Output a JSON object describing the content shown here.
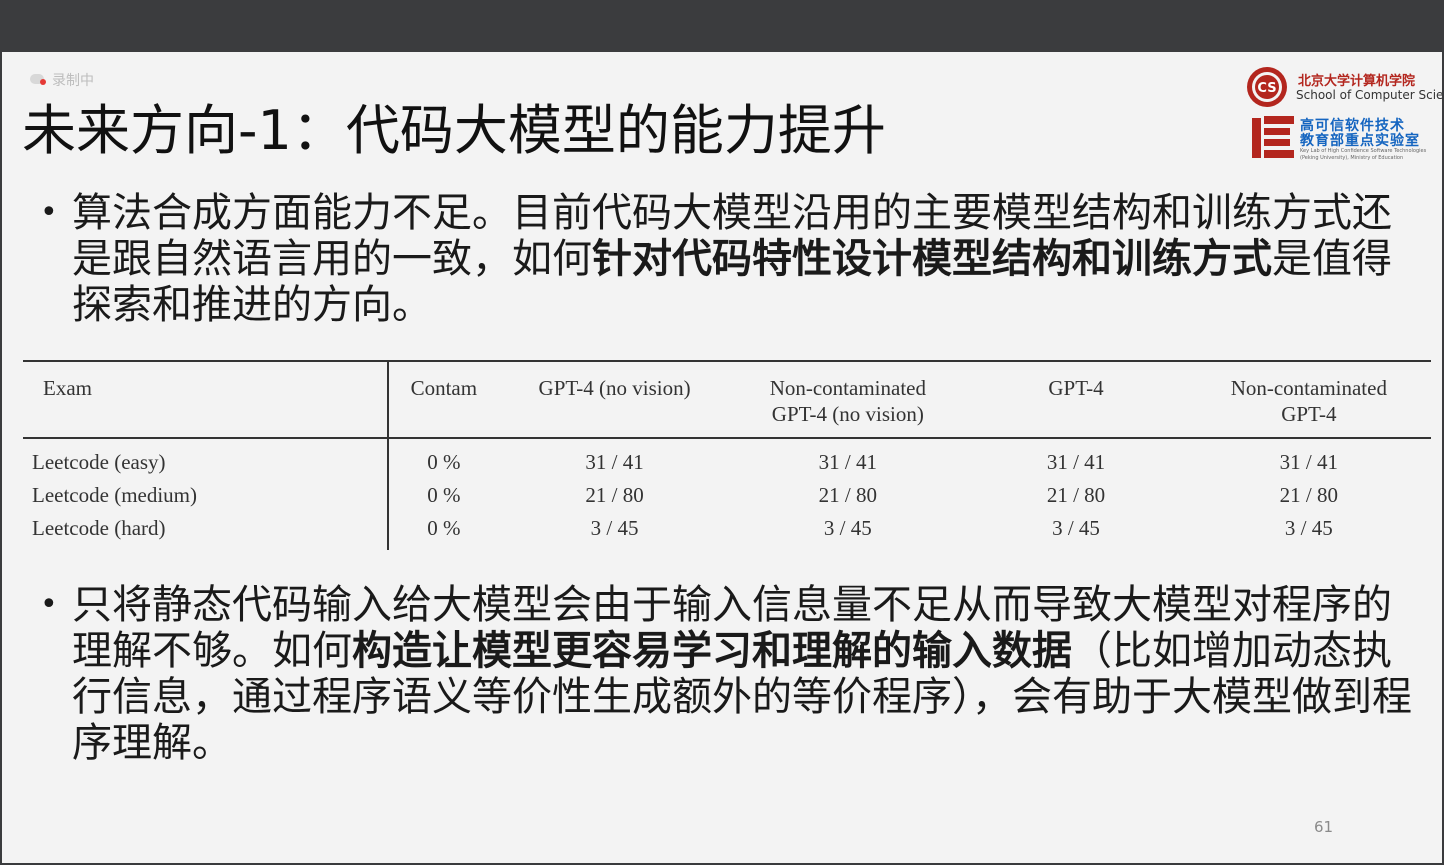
{
  "recording": {
    "label": "录制中"
  },
  "slide": {
    "title": "未来方向-1：代码大模型的能力提升",
    "page_number": "61"
  },
  "logos": {
    "cs_mark": "CS",
    "school_cn": "北京大学计算机学院",
    "school_en": "School of Computer Science",
    "lab_cn_line1": "高可信软件技术",
    "lab_cn_line2": "教育部重点实验室",
    "lab_en_line1": "Key Lab of High Confidence Software Technologies",
    "lab_en_line2": "(Peking University), Ministry of Education"
  },
  "bullet1": {
    "text_before": "算法合成方面能力不足。目前代码大模型沿用的主要模型结构和训练方式还是跟自然语言用的一致，如何",
    "bold": "针对代码特性设计模型结构和训练方式",
    "text_after": "是值得探索和推进的方向。"
  },
  "table": {
    "headers": [
      [
        "Exam"
      ],
      [
        "Contam"
      ],
      [
        "GPT-4 (no vision)"
      ],
      [
        "Non-contaminated",
        "GPT-4 (no vision)"
      ],
      [
        "GPT-4"
      ],
      [
        "Non-contaminated",
        "GPT-4"
      ]
    ],
    "rows": [
      [
        "Leetcode (easy)",
        "0 %",
        "31 / 41",
        "31 / 41",
        "31 / 41",
        "31 / 41"
      ],
      [
        "Leetcode (medium)",
        "0 %",
        "21 / 80",
        "21 / 80",
        "21 / 80",
        "21 / 80"
      ],
      [
        "Leetcode (hard)",
        "0 %",
        "3 / 45",
        "3 / 45",
        "3 / 45",
        "3 / 45"
      ]
    ]
  },
  "bullet2": {
    "text_before": "只将静态代码输入给大模型会由于输入信息量不足从而导致大模型对程序的理解不够。如何",
    "bold": "构造让模型更容易学习和理解的输入数据",
    "text_after": "（比如增加动态执行信息，通过程序语义等价性生成额外的等价程序），会有助于大模型做到程序理解。"
  },
  "colors": {
    "accent_red": "#b3261e",
    "lab_blue": "#1565c0",
    "recording_dot": "#e53935"
  }
}
